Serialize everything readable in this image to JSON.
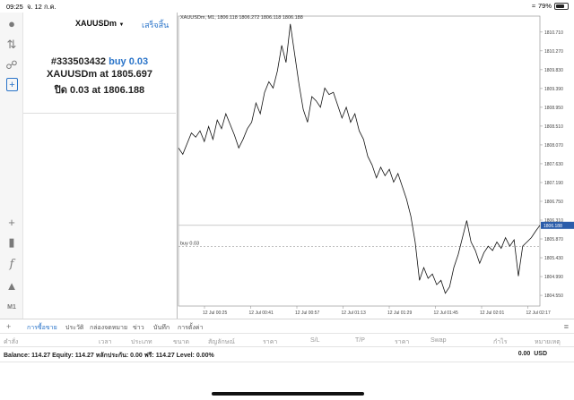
{
  "status_bar": {
    "time": "09:25",
    "date": "จ. 12 ก.ค.",
    "battery": "79%"
  },
  "toolbar": {
    "m1_label": "M1"
  },
  "order_panel": {
    "symbol_selector": "XAUUSDm",
    "done_label": "เสร็จสิ้น",
    "ticket": "#333503432",
    "action": "buy 0.03",
    "open_line": "XAUUSDm at 1805.697",
    "open_prefix": "XAUUSDm at",
    "open_price": "1805.697",
    "close_prefix": "ปิด 0.03 at",
    "close_price": "1806.188"
  },
  "chart": {
    "header": "XAUUSDm, M1, 1806.118 1806.272 1806.118 1806.188",
    "current_price_label": "1806.188",
    "order_line_label": "buy 0.03"
  },
  "chart_data": {
    "type": "line",
    "title": "XAUUSDm, M1, 1806.118 1806.272 1806.118 1806.188",
    "y_ticks": [
      "1810.710",
      "1810.270",
      "1809.830",
      "1809.390",
      "1808.950",
      "1808.510",
      "1808.070",
      "1807.630",
      "1807.190",
      "1806.750",
      "1806.310",
      "1805.870",
      "1805.430",
      "1804.990",
      "1804.550"
    ],
    "x_ticks": [
      "12 Jul 00:25",
      "12 Jul 00:41",
      "12 Jul 00:57",
      "12 Jul 01:13",
      "12 Jul 01:29",
      "12 Jul 01:45",
      "12 Jul 02:01",
      "12 Jul 02:17"
    ],
    "ylim": [
      1804.3,
      1811.0
    ],
    "current_price": 1806.188,
    "order_price": 1805.697,
    "series": [
      {
        "values": [
          1808.0,
          1807.85,
          1808.1,
          1808.35,
          1808.25,
          1808.4,
          1808.15,
          1808.5,
          1808.2,
          1808.65,
          1808.45,
          1808.8,
          1808.55,
          1808.3,
          1808.0,
          1808.2,
          1808.45,
          1808.6,
          1809.05,
          1808.8,
          1809.3,
          1809.55,
          1809.4,
          1809.8,
          1810.4,
          1810.0,
          1810.9,
          1810.2,
          1809.5,
          1808.9,
          1808.6,
          1809.2,
          1809.1,
          1808.95,
          1809.4,
          1809.25,
          1809.3,
          1809.0,
          1808.7,
          1808.95,
          1808.6,
          1808.8,
          1808.4,
          1808.2,
          1807.8,
          1807.6,
          1807.3,
          1807.55,
          1807.35,
          1807.5,
          1807.2,
          1807.4,
          1807.1,
          1806.8,
          1806.4,
          1805.8,
          1804.9,
          1805.2,
          1804.95,
          1805.05,
          1804.8,
          1804.9,
          1804.6,
          1804.75,
          1805.2,
          1805.5,
          1805.9,
          1806.3,
          1805.8,
          1805.6,
          1805.3,
          1805.55,
          1805.7,
          1805.6,
          1805.8,
          1805.65,
          1805.9,
          1805.7,
          1805.85,
          1805.0,
          1805.7,
          1805.8,
          1805.9,
          1806.05,
          1806.188
        ]
      }
    ]
  },
  "tabs": [
    "การซื้อขาย",
    "ประวัติ",
    "กล่องจดหมาย",
    "ข่าว",
    "บันทึก",
    "การตั้งค่า"
  ],
  "table_headers": [
    "คำสั่ง",
    "เวลา",
    "ประเภท",
    "ขนาด",
    "สัญลักษณ์",
    "ราคา",
    "S/L",
    "T/P",
    "ราคา",
    "Swap",
    "กำไร",
    "หมายเหตุ"
  ],
  "balance": {
    "text": "Balance: 114.27  Equity: 114.27  หลักประกัน: 0.00  ฟรี: 114.27  Level: 0.00%",
    "profit": "0.00",
    "currency": "USD"
  }
}
